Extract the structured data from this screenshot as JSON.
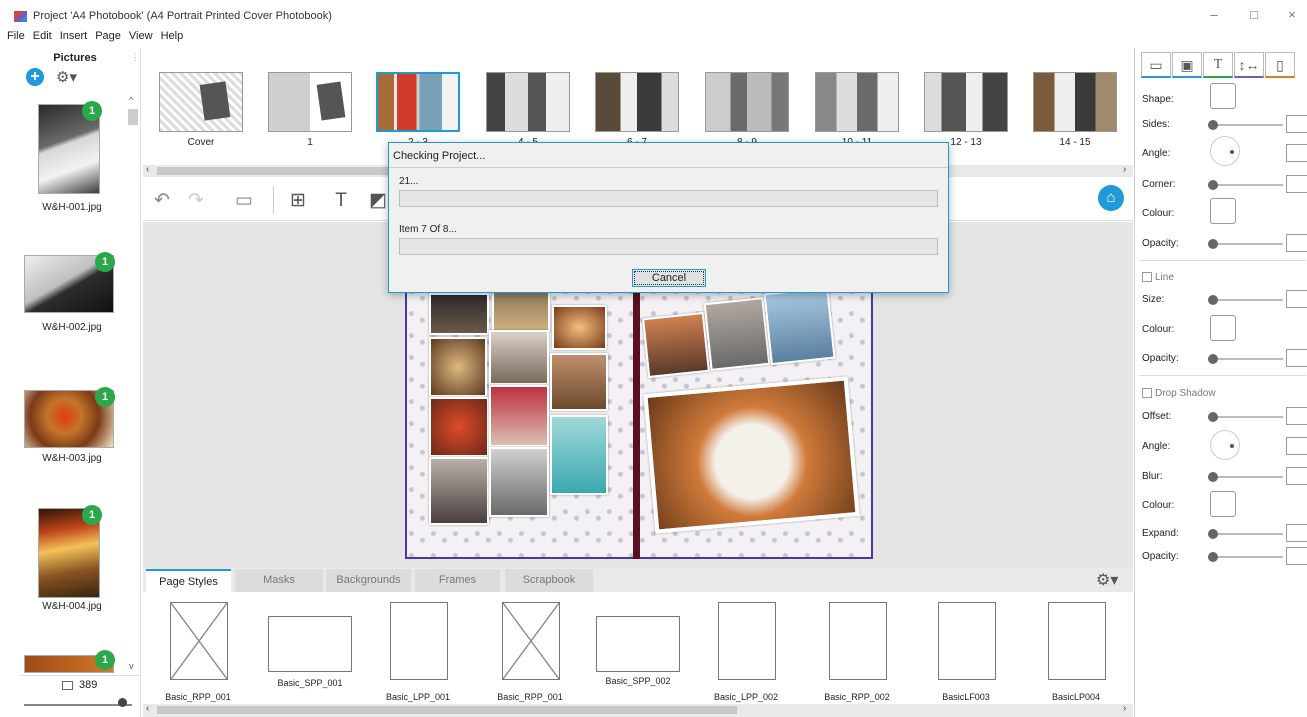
{
  "window": {
    "title": "Project 'A4 Photobook' (A4 Portrait Printed Cover Photobook)",
    "minimize": "–",
    "maximize": "□",
    "close": "×"
  },
  "menu": [
    "File",
    "Edit",
    "Insert",
    "Page",
    "View",
    "Help"
  ],
  "pictures": {
    "title": "Pictures",
    "items": [
      {
        "name": "W&H-001.jpg",
        "count": "1"
      },
      {
        "name": "W&H-002.jpg",
        "count": "1"
      },
      {
        "name": "W&H-003.jpg",
        "count": "1"
      },
      {
        "name": "W&H-004.jpg",
        "count": "1"
      },
      {
        "name": "",
        "count": "1"
      }
    ],
    "total": "389"
  },
  "pages": [
    {
      "label": "Cover"
    },
    {
      "label": "1"
    },
    {
      "label": "2 - 3"
    },
    {
      "label": "4 - 5"
    },
    {
      "label": "6 - 7"
    },
    {
      "label": "8 - 9"
    },
    {
      "label": "10 - 11"
    },
    {
      "label": "12 - 13"
    },
    {
      "label": "14 - 15"
    }
  ],
  "dialog": {
    "title": "Checking Project...",
    "status1": "21...",
    "status2": "Item 7 Of 8...",
    "cancel": "Cancel"
  },
  "bottom_tabs": [
    "Page Styles",
    "Masks",
    "Backgrounds",
    "Frames",
    "Scrapbook"
  ],
  "page_styles": [
    "Basic_RPP_001",
    "Basic_SPP_001",
    "Basic_LPP_001",
    "Basic_RPP_001",
    "Basic_SPP_002",
    "Basic_LPP_002",
    "Basic_RPP_002",
    "BasicLF003",
    "BasicLP004"
  ],
  "properties": {
    "shape": "Shape:",
    "sides": "Sides:",
    "angle": "Angle:",
    "corner": "Corner:",
    "colour": "Colour:",
    "opacity": "Opacity:",
    "line": "Line",
    "size": "Size:",
    "line_colour": "Colour:",
    "line_opacity": "Opacity:",
    "drop_shadow": "Drop Shadow",
    "offset": "Offset:",
    "shadow_angle": "Angle:",
    "blur": "Blur:",
    "shadow_colour": "Colour:",
    "expand": "Expand:",
    "shadow_opacity": "Opacity:"
  },
  "accent_color": "#1e9bd7"
}
